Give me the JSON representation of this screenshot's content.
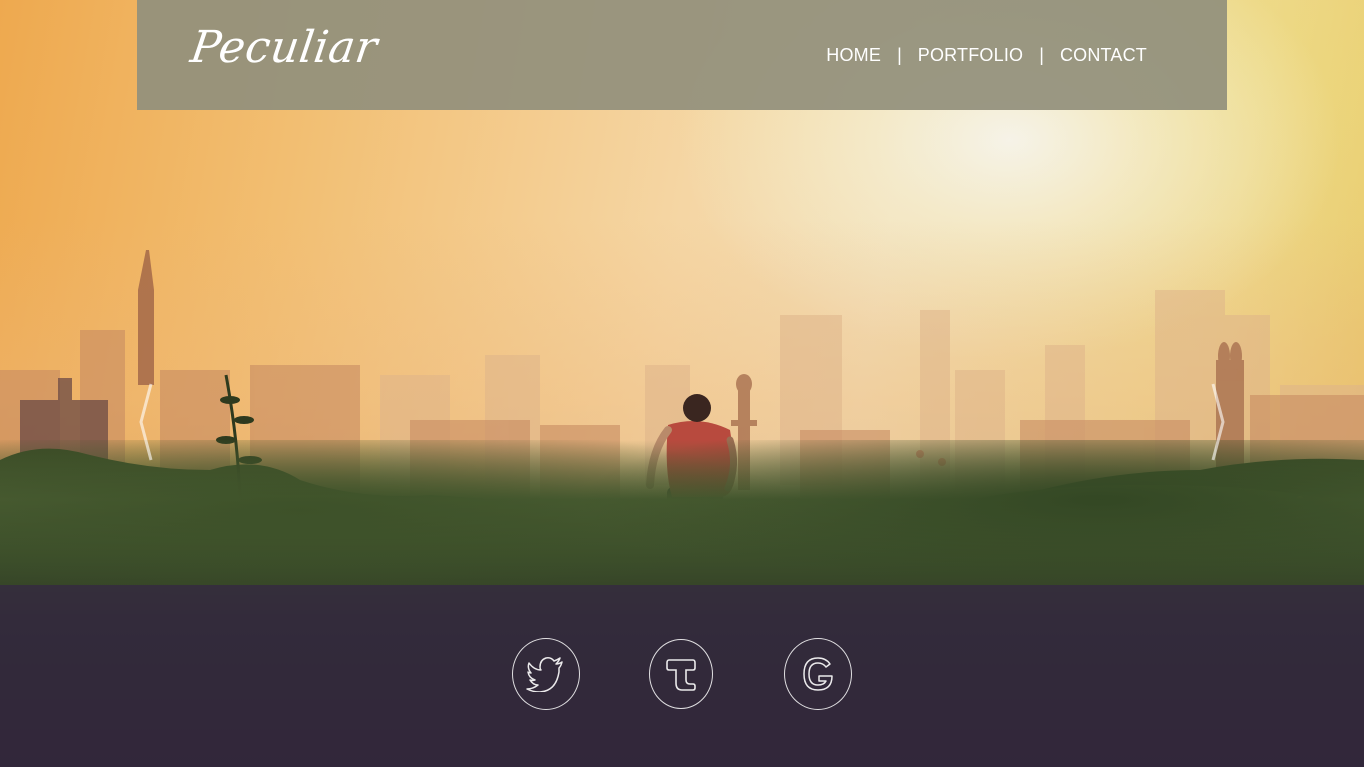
{
  "brand": {
    "logo_text": "Peculiar"
  },
  "nav": {
    "items": [
      {
        "label": "HOME"
      },
      {
        "label": "PORTFOLIO"
      },
      {
        "label": "CONTACT"
      }
    ],
    "separator": "|"
  },
  "carousel": {
    "prev_icon": "chevron-left-icon",
    "next_icon": "chevron-right-icon"
  },
  "social": [
    {
      "icon": "twitter-bird-icon"
    },
    {
      "icon": "tumblr-icon"
    },
    {
      "icon": "google-icon"
    }
  ],
  "colors": {
    "header_bg": "#92907c",
    "footer_band": "#342644",
    "nav_text": "#ffffff"
  }
}
